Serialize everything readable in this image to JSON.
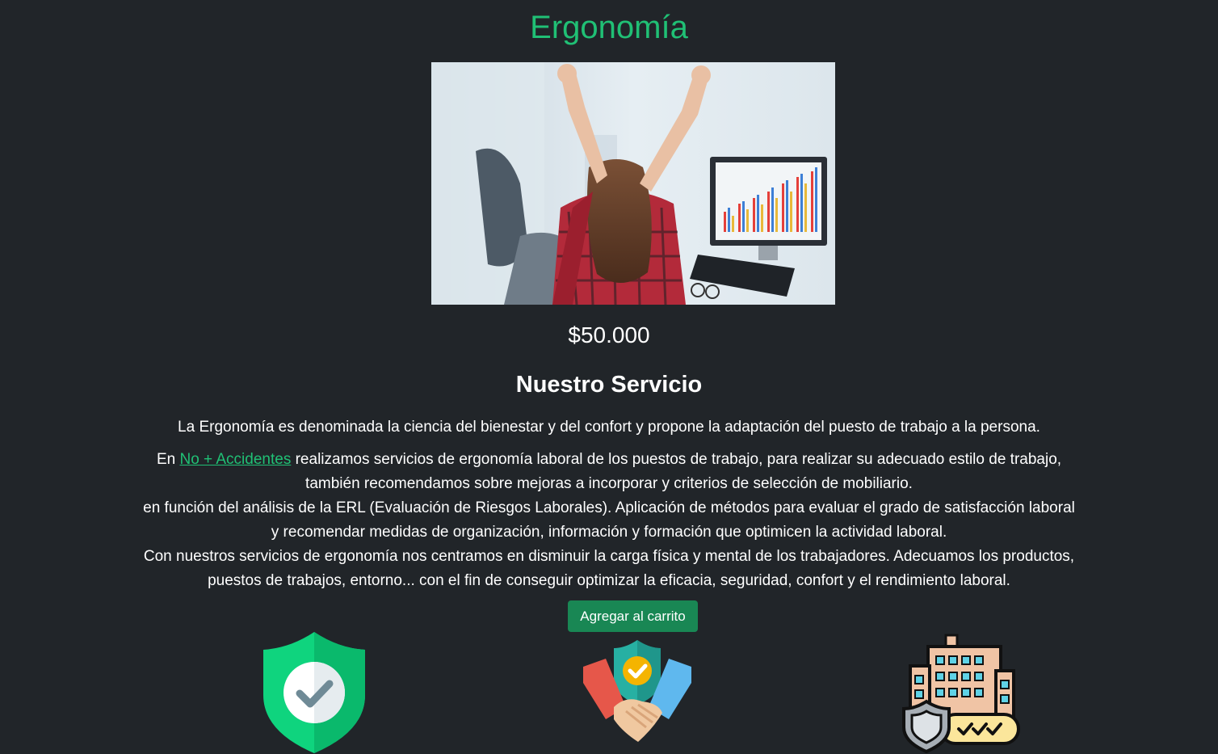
{
  "product": {
    "title": "Ergonomía",
    "price": "$50.000",
    "section_title": "Nuestro Servicio",
    "intro": "La Ergonomía es denominada la ciencia del bienestar y del confort y propone la adaptación del puesto de trabajo a la persona.",
    "para_prefix": "En ",
    "company_link": "No + Accidentes",
    "line1_rest": " realizamos servicios de ergonomía laboral de los puestos de trabajo, para realizar su adecuado estilo de trabajo,",
    "line2": "también recomendamos sobre mejoras a incorporar y criterios de selección de mobiliario.",
    "line3": "en función del análisis de la ERL (Evaluación de Riesgos Laborales). Aplicación de métodos para evaluar el grado de satisfacción laboral",
    "line4": "y recomendar medidas de organización, información y formación que optimicen la actividad laboral.",
    "line5": "Con nuestros servicios de ergonomía nos centramos en disminuir la carga física y mental de los trabajadores. Adecuamos los productos,",
    "line6": "puestos de trabajos, entorno... con el fin de conseguir optimizar la eficacia, seguridad, confort y el rendimiento laboral.",
    "cart_button": "Agregar al carrito"
  },
  "features": [
    {
      "icon": "shield-check-icon"
    },
    {
      "icon": "handshake-shield-icon"
    },
    {
      "icon": "building-insurance-icon"
    }
  ],
  "colors": {
    "background": "#212529",
    "accent": "#20c075",
    "button": "#198754"
  }
}
